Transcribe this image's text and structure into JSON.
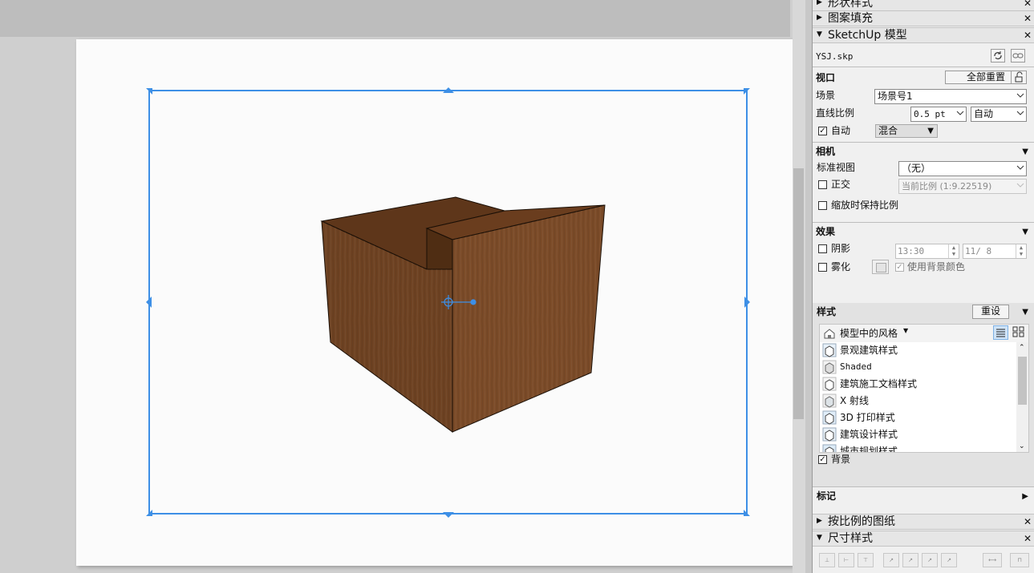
{
  "trays": {
    "shape_style": {
      "label": "形状样式"
    },
    "pattern_fill": {
      "label": "图案填充"
    },
    "sketchup_model": {
      "label": "SketchUp 模型"
    },
    "scaled_drawing": {
      "label": "按比例的图纸"
    },
    "dimension_style": {
      "label": "尺寸样式"
    }
  },
  "model": {
    "filename": "YSJ.skp",
    "viewport": {
      "title": "视口",
      "reset_all_button": "全部重置",
      "scene_label": "场景",
      "scene_value": "场景号1",
      "line_scale_label": "直线比例",
      "line_scale_value": "0.5 pt",
      "line_scale_mode": "自动",
      "auto_checkbox_label": "自动",
      "auto_checked": true,
      "render_mode": "混合"
    },
    "camera": {
      "title": "相机",
      "standard_view_label": "标准视图",
      "standard_view_value": "（无）",
      "ortho_label": "正交",
      "ortho_checked": false,
      "current_scale": "当前比例 (1:9.22519)",
      "keep_scale_label": "缩放时保持比例",
      "keep_scale_checked": false
    },
    "effects": {
      "title": "效果",
      "shadows_label": "阴影",
      "shadows_checked": false,
      "shadow_time": "13:30",
      "shadow_date": "11/ 8",
      "fog_label": "雾化",
      "fog_checked": false,
      "use_bg_color_label": "使用背景颜色",
      "use_bg_color_checked": true
    },
    "styles": {
      "title": "样式",
      "reset_button": "重设",
      "dropdown_label": "模型中的风格",
      "items": [
        {
          "label": "景观建筑样式"
        },
        {
          "label": "Shaded"
        },
        {
          "label": "建筑施工文档样式"
        },
        {
          "label": "X 射线"
        },
        {
          "label": "3D 打印样式"
        },
        {
          "label": "建筑设计样式"
        },
        {
          "label": "城市规划样式"
        }
      ],
      "background_label": "背景",
      "background_checked": true
    },
    "tags": {
      "title": "标记"
    }
  },
  "colors": {
    "selection": "#3d8fe6",
    "wood_front": "#7a4a27",
    "wood_left": "#6b3f20",
    "wood_top": "#5a3418",
    "paper": "#fbfbfb",
    "panel": "#f0f0f0"
  }
}
